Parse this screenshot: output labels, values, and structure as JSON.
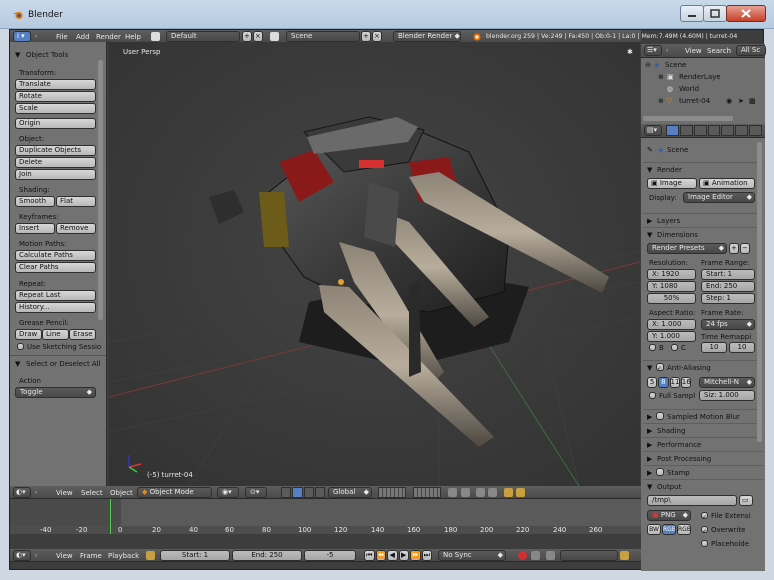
{
  "window": {
    "title": "Blender"
  },
  "info": {
    "menus": [
      "File",
      "Add",
      "Render",
      "Help"
    ],
    "layout": "Default",
    "scene": "Scene",
    "engine": "Blender Render",
    "stats": "blender.org 259 | Ve:249 | Fa:450 | Ob:0-1 | La:0 | Mem:7.49M (4.60M) | turret-04"
  },
  "toolshelf": {
    "header": "Object Tools",
    "transform_label": "Transform:",
    "translate": "Translate",
    "rotate": "Rotate",
    "scale": "Scale",
    "origin": "Origin",
    "object_label": "Object:",
    "duplicate": "Duplicate Objects",
    "delete": "Delete",
    "join": "Join",
    "shading_label": "Shading:",
    "smooth": "Smooth",
    "flat": "Flat",
    "keyframes_label": "Keyframes:",
    "insert": "Insert",
    "remove": "Remove",
    "motion_label": "Motion Paths:",
    "calc_paths": "Calculate Paths",
    "clear_paths": "Clear Paths",
    "repeat_label": "Repeat:",
    "repeat_last": "Repeat Last",
    "history": "History...",
    "grease_label": "Grease Pencil:",
    "draw": "Draw",
    "line": "Line",
    "erase": "Erase",
    "sketching": "Use Sketching Sessio",
    "operator_header": "Select or Deselect All",
    "action_label": "Action",
    "action_value": "Toggle"
  },
  "viewport": {
    "view_name": "User Persp",
    "object_label": "(-5) turret-04",
    "menus": [
      "View",
      "Select",
      "Object"
    ],
    "mode": "Object Mode",
    "orientation": "Global"
  },
  "timeline": {
    "ruler": [
      "-40",
      "-20",
      "0",
      "20",
      "40",
      "60",
      "80",
      "100",
      "120",
      "140",
      "160",
      "180",
      "200",
      "220",
      "240",
      "260"
    ],
    "menus": [
      "View",
      "Frame",
      "Playback"
    ],
    "start": "Start: 1",
    "end": "End: 250",
    "current": "-5",
    "sync": "No Sync"
  },
  "outliner": {
    "menus": [
      "View",
      "Search"
    ],
    "display": "All Sc",
    "items": [
      "Scene",
      "RenderLaye",
      "World",
      "turret-04"
    ]
  },
  "properties": {
    "breadcrumb": "Scene",
    "render_header": "Render",
    "image_btn": "Image",
    "animation_btn": "Animation",
    "display_label": "Display:",
    "display_value": "Image Editor",
    "layers": "Layers",
    "dimensions": "Dimensions",
    "presets": "Render Presets",
    "resolution_label": "Resolution:",
    "res_x": "X: 1920",
    "res_y": "Y: 1080",
    "res_pct": "50%",
    "frame_range_label": "Frame Range:",
    "frame_start": "Start: 1",
    "frame_end": "End: 250",
    "frame_step": "Step: 1",
    "aspect_label": "Aspect Ratio:",
    "aspect_x": "X: 1.000",
    "aspect_y": "Y: 1.000",
    "frame_rate_label": "Frame Rate:",
    "fps": "24 fps",
    "remap_label": "Time Remappi",
    "remap_old": "10",
    "remap_new": "10",
    "border_b": "B",
    "border_c": "C",
    "aa": "Anti-Aliasing",
    "aa_samples": [
      "5",
      "8",
      "11",
      "16"
    ],
    "aa_filter": "Mitchell-N",
    "full_sample": "Full Sampl",
    "filter_size": "Siz: 1.000",
    "motion_blur": "Sampled Motion Blur",
    "shading": "Shading",
    "performance": "Performance",
    "post": "Post Processing",
    "stamp": "Stamp",
    "output": "Output",
    "output_path": "/tmp\\",
    "format": "PNG",
    "file_ext": "File Extensi",
    "color_modes": [
      "BW",
      "RGB",
      "RGBA"
    ],
    "overwrite": "Overwrite",
    "placeholder": "Placeholde"
  }
}
